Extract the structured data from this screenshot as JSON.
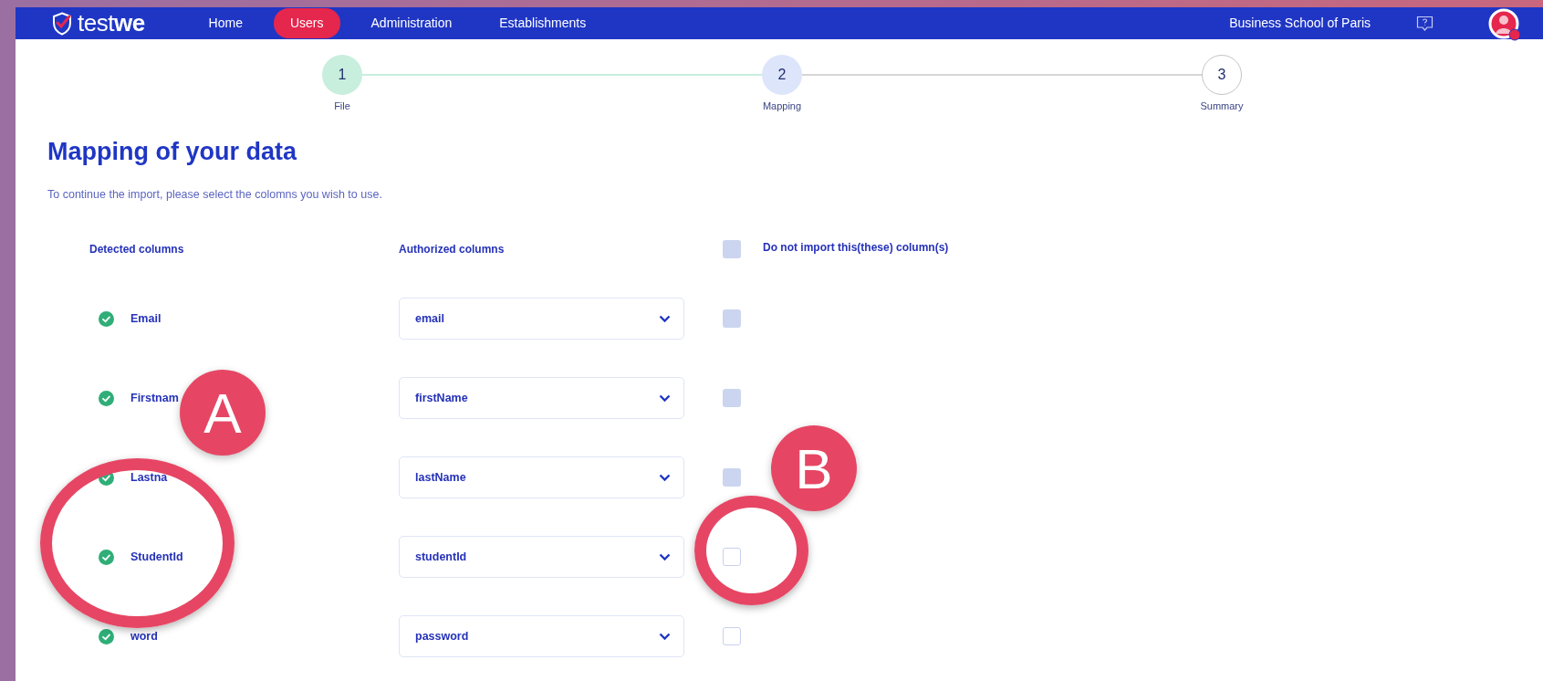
{
  "nav": {
    "logo": {
      "prefix": "test",
      "suffix": "we"
    },
    "links": [
      {
        "label": "Home",
        "selected": false
      },
      {
        "label": "Users",
        "selected": true
      },
      {
        "label": "Administration",
        "selected": false
      },
      {
        "label": "Establishments",
        "selected": false
      }
    ],
    "school": "Business School of Paris"
  },
  "steps": [
    {
      "number": "1",
      "label": "File",
      "completed": true,
      "selected": false
    },
    {
      "number": "2",
      "label": "Mapping",
      "completed": false,
      "selected": true
    },
    {
      "number": "3",
      "label": "Summary",
      "completed": false,
      "selected": false
    }
  ],
  "title": "Mapping of your data",
  "instructions": "To continue the import, please select the colomns you wish to use.",
  "columns": {
    "detected": "Detected columns",
    "authorized": "Authorized columns",
    "skip": {
      "label": "Do not import this(these) column(s)",
      "disabled": true
    }
  },
  "rows": [
    {
      "detected": "Email",
      "matched": true,
      "value": "email",
      "skip_disabled": true
    },
    {
      "detected": "Firstnam",
      "matched": true,
      "value": "firstName",
      "skip_disabled": true
    },
    {
      "detected": "Lastna",
      "matched": true,
      "value": "lastName",
      "skip_disabled": true
    },
    {
      "detected": "StudentId",
      "matched": true,
      "value": "studentId",
      "skip_disabled": false
    },
    {
      "detected": "word",
      "matched": true,
      "value": "password",
      "skip_disabled": false
    }
  ],
  "annotations": [
    {
      "kind": "badge",
      "label": "A"
    },
    {
      "kind": "ring"
    },
    {
      "kind": "badge",
      "label": "B"
    },
    {
      "kind": "ring"
    }
  ]
}
